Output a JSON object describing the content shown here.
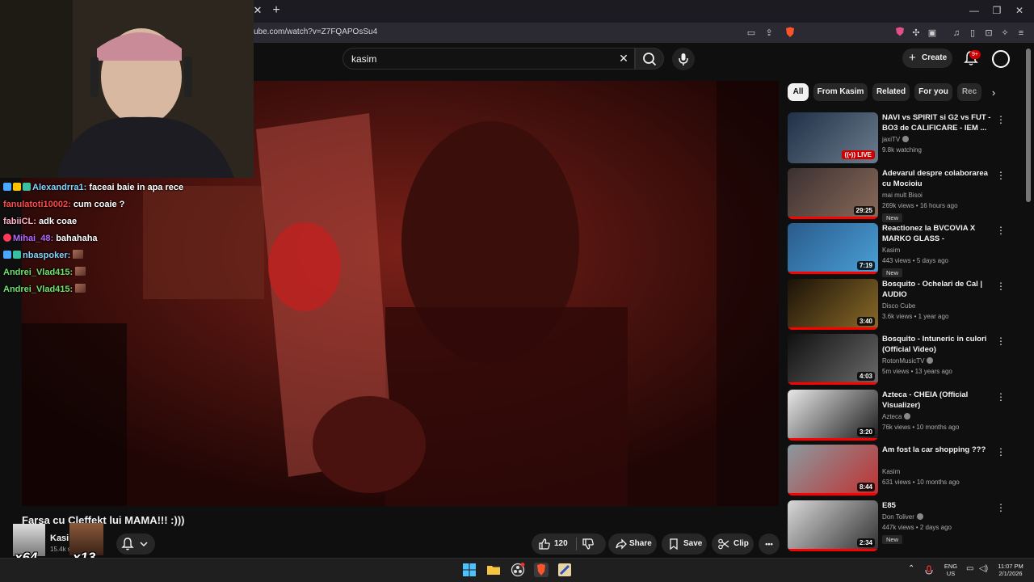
{
  "browser": {
    "url": "ube.com/watch?v=Z7FQAPOsSu4",
    "tab_close": "✕",
    "tab_new": "+",
    "window_controls": [
      "—",
      "❐",
      "✕"
    ],
    "shield_badge": "🛡"
  },
  "header": {
    "search_value": "kasim",
    "create_label": "Create",
    "notification_count": "9+"
  },
  "chat": {
    "messages": [
      {
        "user": "Alexandrra1:",
        "message": "faceai baie in apa rece",
        "user_color": "#7fd6ff",
        "badges": [
          "sword",
          "crown",
          "grid"
        ]
      },
      {
        "user": "fanulatoti10002:",
        "message": "cum coaie ?",
        "user_color": "#ff4a4a",
        "badges": []
      },
      {
        "user": "fabiiCL:",
        "message": "adk coae",
        "user_color": "#ffb0c8",
        "badges": []
      },
      {
        "user": "Mihai_48:",
        "message": "bahahaha",
        "user_color": "#b46aff",
        "badges": [
          "rose"
        ]
      },
      {
        "user": "nbaspoker:",
        "message": "",
        "user_color": "#7fd6ff",
        "badges": [
          "sword",
          "grid"
        ],
        "emote": true
      },
      {
        "user": "Andrei_Vlad415:",
        "message": "",
        "user_color": "#6fe36f",
        "badges": [],
        "emote": true
      },
      {
        "user": "Andrei_Vlad415:",
        "message": "",
        "user_color": "#6fe36f",
        "badges": [],
        "emote": true
      }
    ]
  },
  "video": {
    "title": "Farsa cu Cleffekt lui MAMA!!! :)))",
    "channel_name": "Kasim",
    "subscriber_count": "15.4k s",
    "combo_1": "x64",
    "combo_2": "x13",
    "like_count": "120",
    "share_label": "Share",
    "save_label": "Save",
    "clip_label": "Clip",
    "more_label": "•••"
  },
  "sidebar": {
    "chips": [
      "All",
      "From Kasim",
      "Related",
      "For you",
      "Rec"
    ],
    "recommendations": [
      {
        "title": "NAVI vs SPIRIT si G2 vs FUT - BO3 de CALIFICARE - IEM ...",
        "channel": "jaxiTV",
        "verified": true,
        "meta": "9.8k watching",
        "duration": "LIVE",
        "is_live": true,
        "is_new": false,
        "thumb": [
          "#203048",
          "#6a7c8c"
        ]
      },
      {
        "title": "Adevarul despre colaborarea cu Mocioiu",
        "channel": "mai mult Bisoi",
        "verified": false,
        "meta": "269k views • 16 hours ago",
        "duration": "29:25",
        "is_live": false,
        "is_new": true,
        "thumb": [
          "#3a3030",
          "#8a6a5a"
        ]
      },
      {
        "title": "Reactionez la BVCOVIA X MARKO GLASS - SUBWOOFER...",
        "channel": "Kasim",
        "verified": false,
        "meta": "443 views • 5 days ago",
        "duration": "7:19",
        "is_live": false,
        "is_new": true,
        "thumb": [
          "#2a5a8a",
          "#4aa0d8"
        ]
      },
      {
        "title": "Bosquito - Ochelari de Cal | AUDIO",
        "channel": "Disco Cube",
        "verified": false,
        "meta": "3.6k views • 1 year ago",
        "duration": "3:40",
        "is_live": false,
        "is_new": false,
        "thumb": [
          "#1a1208",
          "#8a6a28"
        ]
      },
      {
        "title": "Bosquito - Intuneric in culori (Official Video)",
        "channel": "RotonMusicTV",
        "verified": true,
        "meta": "5m views • 13 years ago",
        "duration": "4:03",
        "is_live": false,
        "is_new": false,
        "thumb": [
          "#101010",
          "#6a6a6a"
        ]
      },
      {
        "title": "Azteca - CHEIA (Official Visualizer)",
        "channel": "Azteca",
        "verified": true,
        "meta": "76k views • 10 months ago",
        "duration": "3:20",
        "is_live": false,
        "is_new": false,
        "thumb": [
          "#e8e8e8",
          "#1a1a1a"
        ]
      },
      {
        "title": "Am fost la car shopping ???",
        "channel": "Kasim",
        "verified": false,
        "meta": "631 views • 10 months ago",
        "duration": "8:44",
        "is_live": false,
        "is_new": false,
        "thumb": [
          "#8a9aa0",
          "#c03030"
        ]
      },
      {
        "title": "E85",
        "channel": "Don Toliver",
        "verified": true,
        "meta": "447k views • 2 days ago",
        "duration": "2:34",
        "is_live": false,
        "is_new": true,
        "thumb": [
          "#d8d8d8",
          "#303030"
        ]
      }
    ]
  },
  "taskbar": {
    "language": "ENG",
    "region": "US",
    "time": "11:07 PM",
    "date": "2/1/2026"
  },
  "colors": {
    "accent_red": "#ff0000",
    "background": "#0f0f0f",
    "pill_bg": "#272727"
  }
}
